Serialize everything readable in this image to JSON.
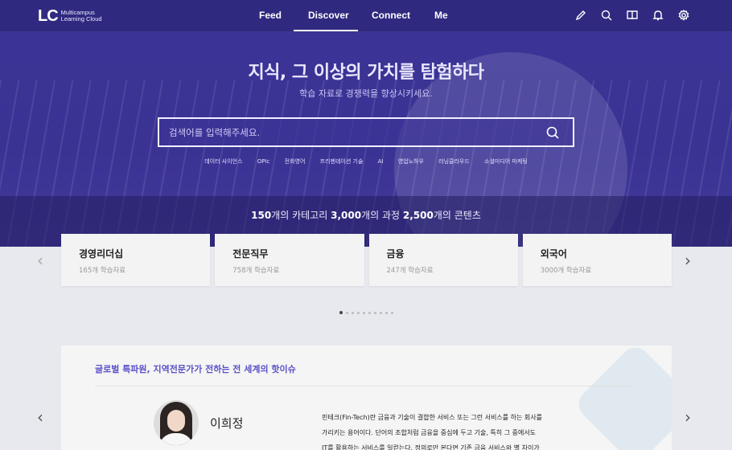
{
  "header": {
    "logo_mark": "LC",
    "logo_line1": "Multicampus",
    "logo_line2": "Learning Cloud",
    "nav": [
      "Feed",
      "Discover",
      "Connect",
      "Me"
    ],
    "active_nav": "Discover",
    "icons": [
      "pencil-icon",
      "search-icon",
      "book-icon",
      "bell-icon",
      "settings-icon"
    ]
  },
  "hero": {
    "title": "지식, 그 이상의 가치를 탐험하다",
    "subtitle": "학습 자료로 경쟁력을 향상시키세요.",
    "search_placeholder": "검색어를 입력해주세요.",
    "keywords": [
      "데이터 사이언스",
      "OPIc",
      "전화영어",
      "프리젠테이션 기술",
      "AI",
      "영업노하우",
      "러닝클라우드",
      "소셜미디어 마케팅"
    ],
    "stats": {
      "categories_count": "150",
      "categories_suffix": "개의 카테고리",
      "courses_count": "3,000",
      "courses_suffix": "개의 과정",
      "contents_count": "2,500",
      "contents_suffix": "개의 콘텐츠"
    }
  },
  "categories": [
    {
      "title": "경영리더십",
      "count": "165개 학습자료"
    },
    {
      "title": "전문직무",
      "count": "758개 학습자료"
    },
    {
      "title": "금융",
      "count": "247개 학습자료"
    },
    {
      "title": "외국어",
      "count": "3000개 학습자료"
    }
  ],
  "carousel": {
    "prev": "‹",
    "next": "›",
    "dot_count": 10,
    "active_dot": 0
  },
  "expert": {
    "section_title": "글로벌 특파원, 지역전문가가 전하는 전 세계의 핫이슈",
    "name": "이희정",
    "text_lines": [
      "핀테크(Fin-Tech)란 금융과 기술이 결합한 서비스 또는 그런 서비스를 하는 회사를",
      "가리키는 용어이다. 단어의 조합처럼 금융을 중심에 두고 기술, 특히 그 중에서도",
      "IT를 활용하는 서비스를 일컫는다. 정의로만 본다면 기존 금융 서비스와 별 차이가"
    ],
    "prev": "‹",
    "next": "›"
  }
}
